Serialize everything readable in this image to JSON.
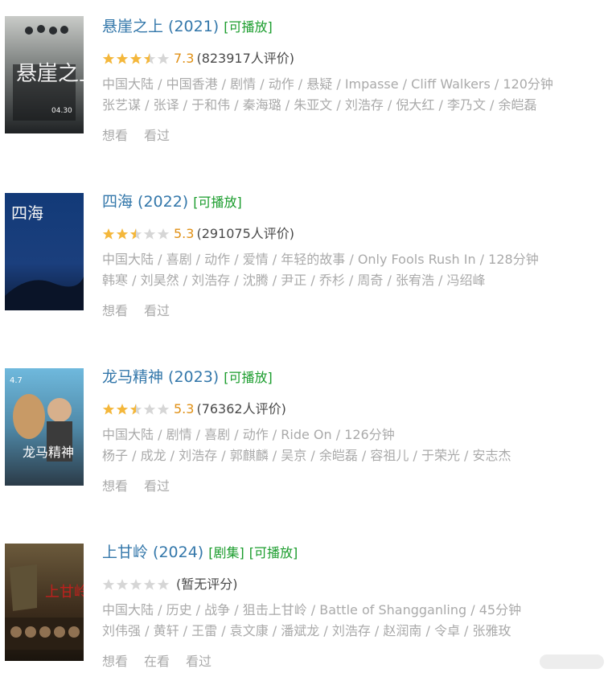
{
  "colors": {
    "title": "#3377aa",
    "playable_tag": "#1a9c2c",
    "score": "#e09015",
    "star_on": "#f4b73b",
    "star_off": "#d6d6d6",
    "meta": "#aaaaaa"
  },
  "movies": [
    {
      "title": "悬崖之上 (2021)",
      "tags": [
        "[可播放]"
      ],
      "stars_filled": 3.5,
      "score": "7.3",
      "count": "(823917人评价)",
      "meta_line1": "中国大陆 / 中国香港 / 剧情 / 动作 / 悬疑 / Impasse / Cliff Walkers / 120分钟",
      "meta_line2": "张艺谋 / 张译 / 于和伟 / 秦海璐 / 朱亚文 / 刘浩存 / 倪大红 / 李乃文 / 余皑磊",
      "actions": [
        "想看",
        "看过"
      ],
      "poster_text": "悬崖之上",
      "poster_date": "04.30"
    },
    {
      "title": "四海 (2022)",
      "tags": [
        "[可播放]"
      ],
      "stars_filled": 2.5,
      "score": "5.3",
      "count": "(291075人评价)",
      "meta_line1": "中国大陆 / 喜剧 / 动作 / 爱情 / 年轻的故事 / Only Fools Rush In / 128分钟",
      "meta_line2": "韩寒 / 刘昊然 / 刘浩存 / 沈腾 / 尹正 / 乔杉 / 周奇 / 张宥浩 / 冯绍峰",
      "actions": [
        "想看",
        "看过"
      ],
      "poster_text": "四海"
    },
    {
      "title": "龙马精神 (2023)",
      "tags": [
        "[可播放]"
      ],
      "stars_filled": 2.5,
      "score": "5.3",
      "count": "(76362人评价)",
      "meta_line1": "中国大陆 / 剧情 / 喜剧 / 动作 / Ride On / 126分钟",
      "meta_line2": "杨子 / 成龙 / 刘浩存 / 郭麒麟 / 吴京 / 余皑磊 / 容祖儿 / 于荣光 / 安志杰",
      "actions": [
        "想看",
        "看过"
      ],
      "poster_text": "龙马精神",
      "poster_date": "4.7"
    },
    {
      "title": "上甘岭 (2024)",
      "tags": [
        "[剧集]",
        "[可播放]"
      ],
      "stars_filled": 0,
      "score": "",
      "count": "(暂无评分)",
      "meta_line1": "中国大陆 / 历史 / 战争 / 狙击上甘岭 / Battle of Shangganling / 45分钟",
      "meta_line2": "刘伟强 / 黄轩 / 王雷 / 袁文康 / 潘斌龙 / 刘浩存 / 赵润南 / 令卓 / 张雅玫",
      "actions": [
        "想看",
        "在看",
        "看过"
      ],
      "poster_text": "上甘岭"
    }
  ]
}
